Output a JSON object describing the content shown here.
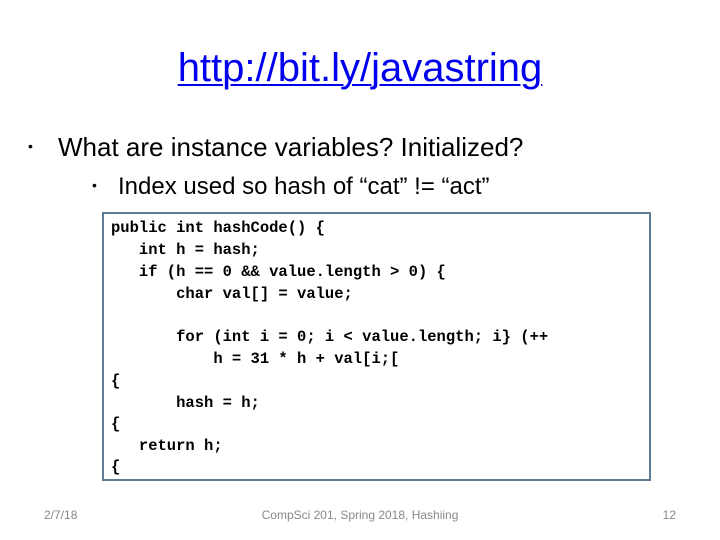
{
  "slide": {
    "title_link": "http://bit.ly/javastring",
    "bullets": [
      {
        "level": 1,
        "text": "What are instance variables? Initialized?"
      },
      {
        "level": 2,
        "text": "Index used so hash of “cat” != “act”"
      }
    ],
    "bullet_glyph": "•",
    "code_lines": [
      "public int hashCode() {",
      "   int h = hash;",
      "   if (h == 0 && value.length > 0) {",
      "       char val[] = value;",
      "",
      "       for (int i = 0; i < value.length; i} (++",
      "           h = 31 * h + val[i;[",
      "{",
      "       hash = h;",
      "{",
      "   return h;",
      "{"
    ],
    "footer": {
      "date": "2/7/18",
      "center": "CompSci 201, Spring 2018,  Hashiing",
      "page_number": "12"
    },
    "colors": {
      "link": "#0000ee",
      "code_border": "#5b7b99",
      "footer_text": "#888888"
    }
  }
}
